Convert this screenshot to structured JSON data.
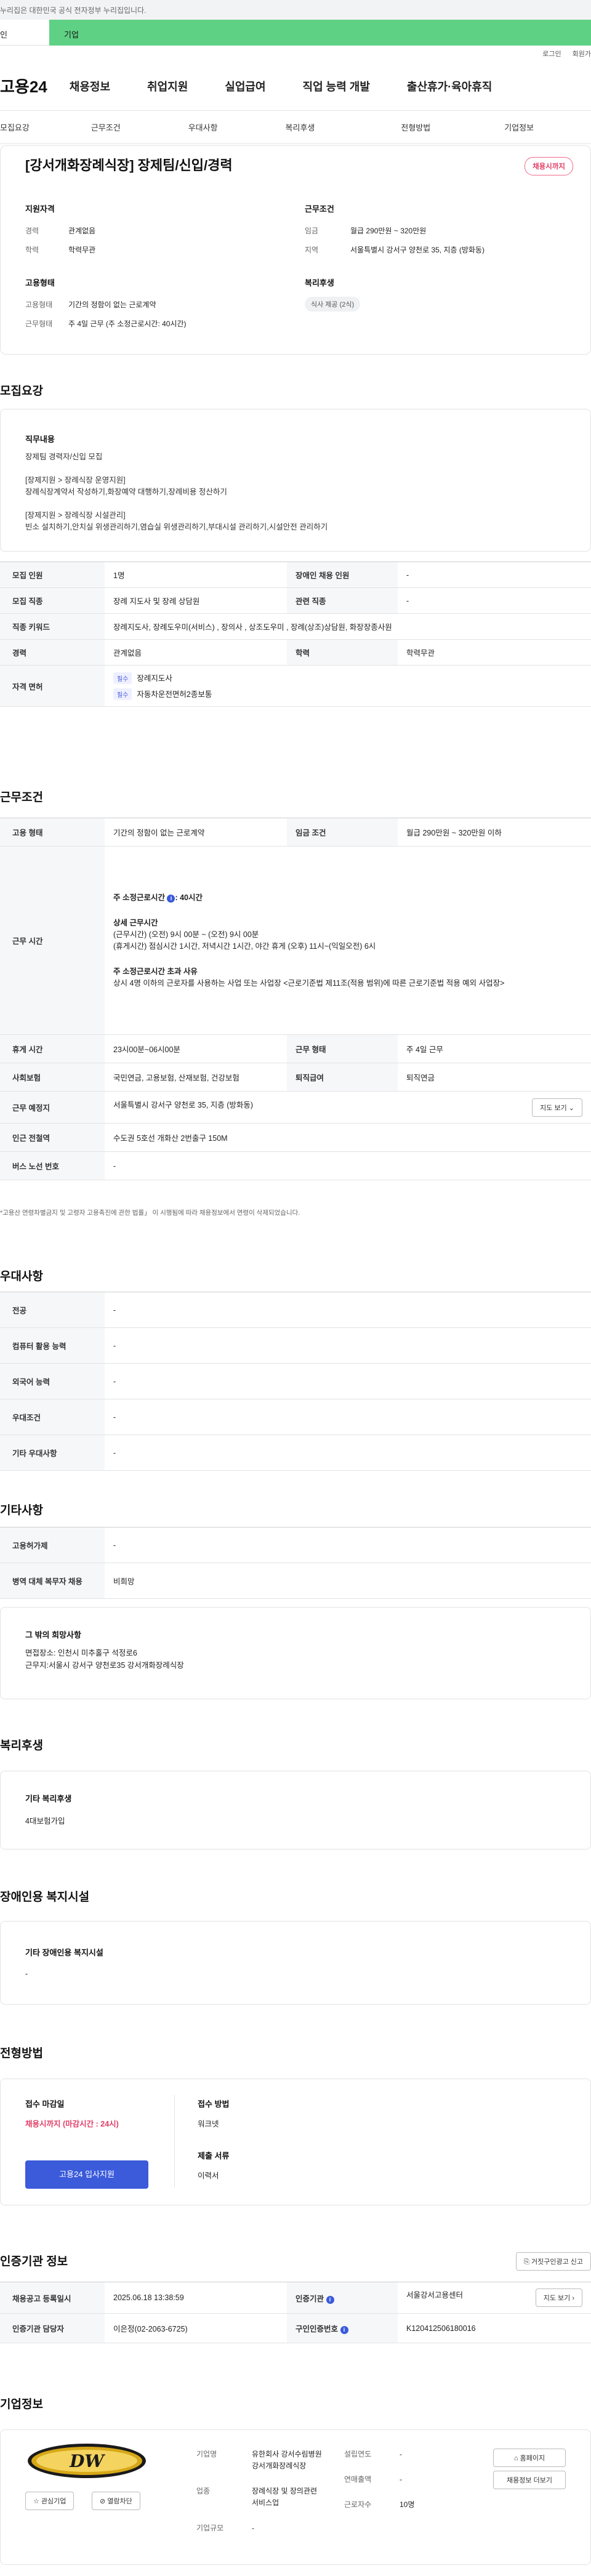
{
  "gov_notice": "누리집은 대한민국 공식 전자정부 누리집입니다.",
  "top_tabs": [
    "인",
    "기업"
  ],
  "util": [
    "로그인",
    "회원가"
  ],
  "logo": "고용24",
  "gnb": [
    "채용정보",
    "취업지원",
    "실업급여",
    "직업 능력 개발",
    "출산휴가·육아휴직"
  ],
  "anchors": [
    "모집요강",
    "근무조건",
    "우대사항",
    "복리후생",
    "전형방법",
    "기업정보"
  ],
  "job": {
    "title": "[강서개화장례식장] 장제팀/신입/경력",
    "deadline_pill": "채용시까지",
    "qual_title": "지원자격",
    "qual": [
      {
        "k": "경력",
        "v": "관계없음"
      },
      {
        "k": "학력",
        "v": "학력무관"
      }
    ],
    "cond_title": "근무조건",
    "cond": [
      {
        "k": "임금",
        "v": "월급 290만원 ~ 320만원"
      },
      {
        "k": "지역",
        "v": "서울특별시 강서구 양천로 35, 지층 (방화동)"
      }
    ],
    "employ_title": "고용형태",
    "employ": [
      {
        "k": "고용형태",
        "v": "기간의 정함이 없는 근로계약"
      },
      {
        "k": "근무형태",
        "v": "주 4일 근무 (주 소정근로시간: 40시간)"
      }
    ],
    "welfare_title": "복리후생",
    "welfare_tag": "식사 제공 (2식)"
  },
  "recruit": {
    "title": "모집요강",
    "duty_title": "직무내용",
    "duty_lines": [
      "장제팀 경력자/신입 모집",
      "",
      "[장제지원 > 장례식장 운영지원]",
      "장례식장계약서 작성하기,화장예약 대행하기,장례비용 정산하기",
      "",
      "[장제지원 > 장례식장 시설관리]",
      "빈소 설치하기,안치실 위생관리하기,염습실 위생관리하기,부대시설 관리하기,시설안전 관리하기"
    ],
    "rows": [
      {
        "h1": "모집 인원",
        "v1": "1명",
        "h2": "장애인 채용 인원",
        "v2": "-"
      },
      {
        "h1": "모집 직종",
        "v1": "장례 지도사 및 장례 상담원",
        "h2": "관련 직종",
        "v2": "-"
      },
      {
        "h1": "직종 키워드",
        "v1": "장례지도사, 장례도우미(서비스) , 장의사 , 상조도우미 , 장례(상조)상담원, 화장장종사원"
      },
      {
        "h1": "경력",
        "v1": "관계없음",
        "h2": "학력",
        "v2": "학력무관"
      }
    ],
    "license_h": "자격 면허",
    "licenses": [
      {
        "tag": "필수",
        "name": "장례지도사"
      },
      {
        "tag": "필수",
        "name": "자동차운전면허2종보통"
      }
    ]
  },
  "work": {
    "title": "근무조건",
    "employ_h": "고용 형태",
    "employ_v": "기간의 정함이 없는 근로계약",
    "wage_h": "임금 조건",
    "wage_v": "월급 290만원 ~ 320만원 이하",
    "time_h": "근무 시간",
    "time_week": "주 소정근로시간",
    "time_week_v": ": 40시간",
    "time_detail_title": "상세 근무시간",
    "time_detail_1": "(근무시간) (오전) 9시 00분 ~ (오전) 9시 00분",
    "time_detail_2": "(휴게시간) 점심시간 1시간, 저녁시간 1시간,  야간 휴게 (오후) 11시~(익일오전) 6시",
    "time_over_title": "주 소정근로시간 초과 사유",
    "time_over": "상시 4명 이하의 근로자를 사용하는 사업 또는 사업장 <근로기준법 제11조(적용 범위)에 따른 근로기준법 적용 예외 사업장>",
    "rest_h": "휴게 시간",
    "rest_v": "23시00분~06시00분",
    "type_h": "근무 형태",
    "type_v": "주 4일 근무",
    "ins_h": "사회보험",
    "ins_v": "국민연금, 고용보험, 산재보험, 건강보험",
    "sev_h": "퇴직급여",
    "sev_v": "퇴직연금",
    "place_h": "근무 예정지",
    "place_v": "서울특별시 강서구 양천로 35, 지층 (방화동)",
    "map_btn": "지도 보기",
    "subway_h": "인근 전철역",
    "subway_v": "수도권 5호선 개화산 2번출구 150M",
    "bus_h": "버스 노선 번호",
    "bus_v": "-",
    "note": "*고용산 연령차별금지 및 고령자 고용촉진에 관한 법률」 이 시행됨에 따라 채용정보에서 연령이 삭제되었습니다."
  },
  "prefer": {
    "title": "우대사항",
    "rows": [
      {
        "h": "전공",
        "v": "-"
      },
      {
        "h": "컴퓨터 활용 능력",
        "v": "-"
      },
      {
        "h": "외국어 능력",
        "v": "-"
      },
      {
        "h": "우대조건",
        "v": "-"
      },
      {
        "h": "기타 우대사항",
        "v": "-"
      }
    ]
  },
  "etc": {
    "title": "기타사항",
    "rows": [
      {
        "h": "고용허가제",
        "v": "-"
      },
      {
        "h": "병역 대체 복무자 채용",
        "v": "비희망"
      }
    ],
    "other_title": "그 밖의 희망사항",
    "other_1": "면접장소: 인천시 미추홀구 석정로6",
    "other_2": "근무지:서울시 강서구 양천로35 강서개화장례식장"
  },
  "benefit": {
    "title": "복리후생",
    "box_title": "기타 복리후생",
    "box_v": "4대보험가입"
  },
  "disabled": {
    "title": "장애인용 복지시설",
    "box_title": "기타 장애인용 복지시설",
    "box_v": "-"
  },
  "selection": {
    "title": "전형방법",
    "deadline_title": "접수 마감일",
    "deadline_v": "채용시까지 (마감시간 : 24시)",
    "apply_btn": "고용24 입사지원",
    "method_title": "접수 방법",
    "method_v": "워크넷",
    "docs_title": "제출 서류",
    "docs_v": "이력서"
  },
  "cert": {
    "title": "인증기관 정보",
    "report_btn": "거짓구인광고 신고",
    "rows": [
      {
        "h1": "채용공고 등록일시",
        "v1": "2025.06.18 13:38:59",
        "h2": "인증기관",
        "v2": "서울강서고용센터",
        "btn": "지도 보기"
      },
      {
        "h1": "인증기관 담당자",
        "v1": "이은정(02-2063-6725)",
        "h2": "구인인증번호",
        "v2": "K120412506180016"
      }
    ]
  },
  "company": {
    "title": "기업정보",
    "logo_text": "DW",
    "fav_btn": "관심기업",
    "block_btn": "열람차단",
    "name_h": "기업명",
    "name_v": "유한회사 강서수림병원강서개화장례식장",
    "industry_h": "업종",
    "industry_v": "장례식장 및 장의관련 서비스업",
    "scale_h": "기업규모",
    "scale_v": "-",
    "year_h": "설립연도",
    "year_v": "-",
    "sales_h": "연매출액",
    "sales_v": "-",
    "emp_h": "근로자수",
    "emp_v": "10명",
    "home_btn": "홈페이지",
    "more_btn": "채용정보 더보기"
  }
}
